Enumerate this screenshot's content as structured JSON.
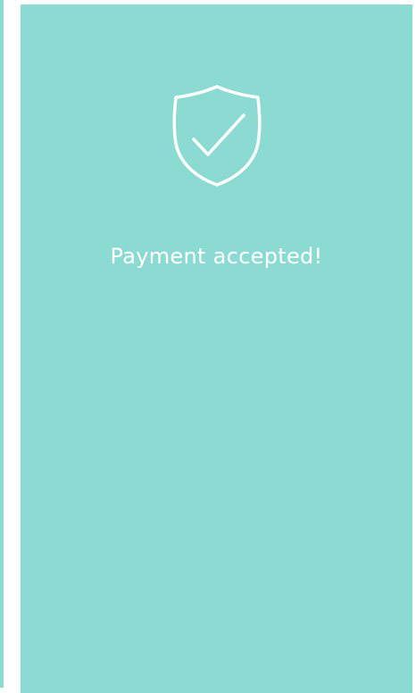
{
  "theme": {
    "panel_color": "#8CDBD3",
    "foreground_color": "#FFFFFF"
  },
  "status": {
    "icon": "shield-check-icon",
    "message": "Payment accepted!"
  }
}
